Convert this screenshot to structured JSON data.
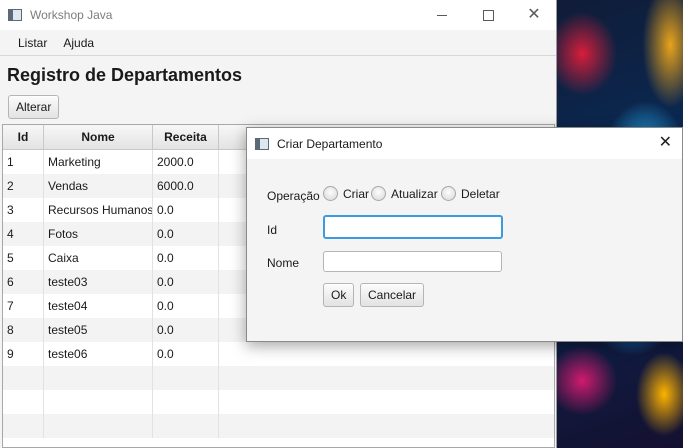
{
  "window": {
    "title": "Workshop Java"
  },
  "menu": {
    "items": [
      "Listar",
      "Ajuda"
    ]
  },
  "page": {
    "title": "Registro de Departamentos"
  },
  "toolbar": {
    "alterar_label": "Alterar"
  },
  "table": {
    "columns": [
      "Id",
      "Nome",
      "Receita"
    ],
    "rows": [
      [
        "1",
        "Marketing",
        "2000.0"
      ],
      [
        "2",
        "Vendas",
        "6000.0"
      ],
      [
        "3",
        "Recursos Humanos",
        "0.0"
      ],
      [
        "4",
        "Fotos",
        "0.0"
      ],
      [
        "5",
        "Caixa",
        "0.0"
      ],
      [
        "6",
        "teste03",
        "0.0"
      ],
      [
        "7",
        "teste04",
        "0.0"
      ],
      [
        "8",
        "teste05",
        "0.0"
      ],
      [
        "9",
        "teste06",
        "0.0"
      ]
    ]
  },
  "dialog": {
    "title": "Criar Departamento",
    "operacao_label": "Operação",
    "options": [
      "Criar",
      "Atualizar",
      "Deletar"
    ],
    "id_label": "Id",
    "id_value": "",
    "nome_label": "Nome",
    "nome_value": "",
    "ok_label": "Ok",
    "cancel_label": "Cancelar"
  }
}
